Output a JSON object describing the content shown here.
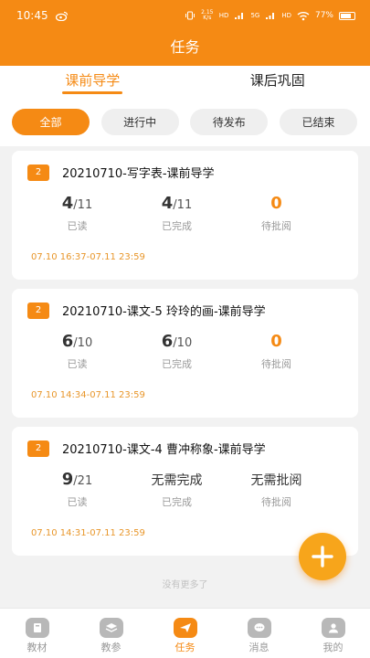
{
  "status_bar": {
    "time": "10:45",
    "network_speed": "2.15 K/s",
    "signal_labels": [
      "HD",
      "5G",
      "HD"
    ],
    "battery": "77%"
  },
  "page_title": "任务",
  "main_tabs": [
    {
      "label": "课前导学",
      "active": true
    },
    {
      "label": "课后巩固",
      "active": false
    }
  ],
  "filters": [
    {
      "label": "全部",
      "active": true
    },
    {
      "label": "进行中",
      "active": false
    },
    {
      "label": "待发布",
      "active": false
    },
    {
      "label": "已结束",
      "active": false
    }
  ],
  "tasks": [
    {
      "badge": "2",
      "title": "20210710-写字表-课前导学",
      "read": {
        "value": "4",
        "total": "/11",
        "label": "已读"
      },
      "completed": {
        "value": "4",
        "total": "/11",
        "label": "已完成"
      },
      "pending": {
        "value": "0",
        "label": "待批阅"
      },
      "time": "07.10 16:37-07.11 23:59"
    },
    {
      "badge": "2",
      "title": "20210710-课文-5 玲玲的画-课前导学",
      "read": {
        "value": "6",
        "total": "/10",
        "label": "已读"
      },
      "completed": {
        "value": "6",
        "total": "/10",
        "label": "已完成"
      },
      "pending": {
        "value": "0",
        "label": "待批阅"
      },
      "time": "07.10 14:34-07.11 23:59"
    },
    {
      "badge": "2",
      "title": "20210710-课文-4 曹冲称象-课前导学",
      "read": {
        "value": "9",
        "total": "/21",
        "label": "已读"
      },
      "completed": {
        "text": "无需完成",
        "label": "已完成"
      },
      "pending": {
        "text": "无需批阅",
        "label": "待批阅"
      },
      "time": "07.10 14:31-07.11 23:59"
    }
  ],
  "no_more": "没有更多了",
  "fab": {
    "icon": "plus-icon",
    "color": "#f7a51b"
  },
  "bottom_nav": [
    {
      "label": "教材",
      "icon": "book-icon",
      "active": false
    },
    {
      "label": "教参",
      "icon": "layers-icon",
      "active": false
    },
    {
      "label": "任务",
      "icon": "paper-plane-icon",
      "active": true
    },
    {
      "label": "消息",
      "icon": "chat-bubble-icon",
      "active": false
    },
    {
      "label": "我的",
      "icon": "user-icon",
      "active": false
    }
  ],
  "colors": {
    "accent": "#f58a14",
    "inactive": "#b8b8b8",
    "background": "#f2f2f2"
  }
}
